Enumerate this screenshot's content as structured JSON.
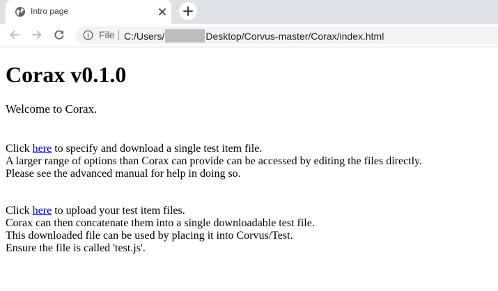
{
  "tab": {
    "title": "Intro page"
  },
  "toolbar": {
    "scheme": "File",
    "url_before": "C:/Users/",
    "url_after": "Desktop/Corvus-master/Corax/index.html"
  },
  "page": {
    "heading": "Corax v0.1.0",
    "welcome": "Welcome to Corax.",
    "section1": {
      "click": "Click",
      "link": "here",
      "after_link": "to specify and download a single test item file.",
      "line2": "A larger range of options than Corax can provide can be accessed by editing the files directly.",
      "line3": "Please see the advanced manual for help in doing so."
    },
    "section2": {
      "click": "Click",
      "link": "here",
      "after_link": "to upload your test item files.",
      "line2": "Corax can then concatenate them into a single downloadable test file.",
      "line3": "This downloaded file can be used by placing it into Corvus/Test.",
      "line4": "Ensure the file is called 'test.js'."
    }
  },
  "icons": {
    "favicon": "globe-icon",
    "close": "close-icon",
    "new_tab": "plus-icon",
    "back": "arrow-left-icon",
    "forward": "arrow-right-icon",
    "reload": "reload-icon",
    "info": "info-icon"
  },
  "colors": {
    "tabstrip": "#dee1e6",
    "omnibox": "#f1f3f4",
    "link": "#0000ee",
    "redaction": "#bdbdbd"
  }
}
